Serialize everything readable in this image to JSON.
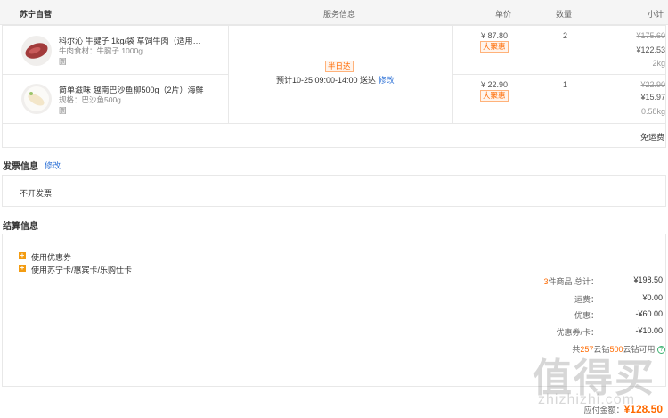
{
  "header": {
    "store": "苏宁自营",
    "service": "服务信息",
    "price": "单价",
    "qty": "数量",
    "subtotal": "小计"
  },
  "items": [
    {
      "name": "科尔沁 牛腱子 1kg/袋 草饲牛肉（适用…",
      "spec": "牛肉食材：牛腱子 1000g",
      "tag": "圜",
      "price": "¥ 87.80",
      "badge": "大聚惠",
      "qty": "2",
      "orig_total": "¥175.60",
      "total": "¥122.53",
      "weight": "2kg"
    },
    {
      "name": "简单滋味 越南巴沙鱼柳500g（2片）海鲜",
      "spec": "规格：巴沙鱼500g",
      "tag": "圜",
      "price": "¥ 22.90",
      "badge": "大聚惠",
      "qty": "1",
      "orig_total": "¥22.90",
      "total": "¥15.97",
      "weight": "0.58kg"
    }
  ],
  "service": {
    "badge": "半日达",
    "text": "预计10-25 09:00-14:00 送达",
    "modify": "修改"
  },
  "shipping": "免运费",
  "invoice": {
    "title": "发票信息",
    "modify": "修改",
    "value": "不开发票"
  },
  "settlement": {
    "title": "结算信息",
    "coupon": "使用优惠券",
    "card": "使用苏宁卡/惠宾卡/乐购仕卡",
    "count_num": "3",
    "count_suffix": "件商品",
    "total_label": "总计：",
    "total": "¥198.50",
    "freight_label": "运费：",
    "freight": "¥0.00",
    "discount_label": "优惠：",
    "discount": "-¥60.00",
    "coupon_label": "优惠券/卡：",
    "coupon_val": "-¥10.00",
    "points_prefix": "共",
    "points_num": "257",
    "points_mid": "云钻",
    "points_num2": "500",
    "points_suffix": "云钻可用",
    "pay_label": "应付金额：",
    "pay": "¥128.50"
  },
  "watermark": {
    "text": "值得买",
    "url": "zhizhizhi.com"
  }
}
